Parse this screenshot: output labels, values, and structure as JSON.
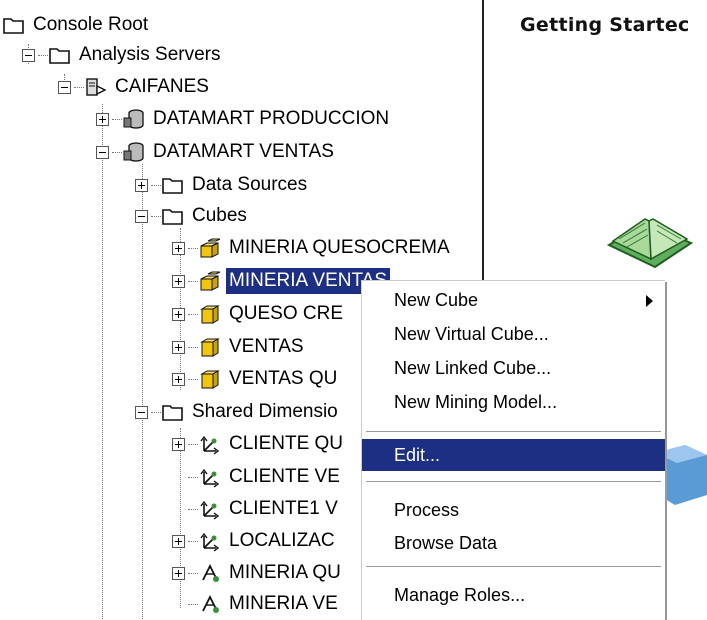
{
  "tree": {
    "console_root": "Console Root",
    "analysis_servers": "Analysis Servers",
    "server": "CAIFANES",
    "db1": "DATAMART PRODUCCION",
    "db2": "DATAMART VENTAS",
    "data_sources": "Data Sources",
    "cubes": "Cubes",
    "cube_items": [
      "MINERIA QUESOCREMA",
      "MINERIA VENTAS",
      "QUESO CRE",
      "VENTAS",
      "VENTAS QU"
    ],
    "shared_dimensions": "Shared Dimensio",
    "dimension_items": [
      "CLIENTE QU",
      "CLIENTE VE",
      "CLIENTE1 V",
      "LOCALIZAC",
      "MINERIA QU",
      "MINERIA VE"
    ]
  },
  "right_pane": {
    "title": "Getting Startec"
  },
  "context_menu": {
    "items": [
      {
        "label": "New Cube",
        "submenu": true
      },
      {
        "label": "New Virtual Cube..."
      },
      {
        "label": "New Linked Cube..."
      },
      {
        "label": "New Mining Model..."
      },
      {
        "label": "Edit...",
        "highlighted": true
      },
      {
        "label": "Process"
      },
      {
        "label": "Browse Data"
      },
      {
        "label": "Manage Roles..."
      }
    ]
  },
  "colors": {
    "selection": "#1c2f82",
    "cube_yellow": "#f1c40f",
    "dimension_green": "#3a8f3a"
  }
}
